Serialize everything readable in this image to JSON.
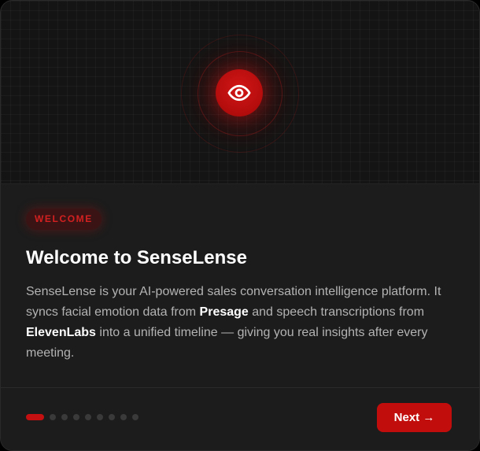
{
  "hero": {
    "icon": "eye-icon",
    "accent_color": "#c20d0d"
  },
  "badge": {
    "label": "WELCOME"
  },
  "title": "Welcome to SenseLense",
  "description": {
    "part1": "SenseLense is your AI-powered sales conversation intelligence platform. It syncs facial emotion data from ",
    "strong1": "Presage",
    "part2": " and speech transcriptions from ",
    "strong2": "ElevenLabs",
    "part3": " into a unified timeline — giving you real insights after every meeting."
  },
  "pagination": {
    "total": 9,
    "current": 1
  },
  "next_button": {
    "label": "Next →"
  }
}
